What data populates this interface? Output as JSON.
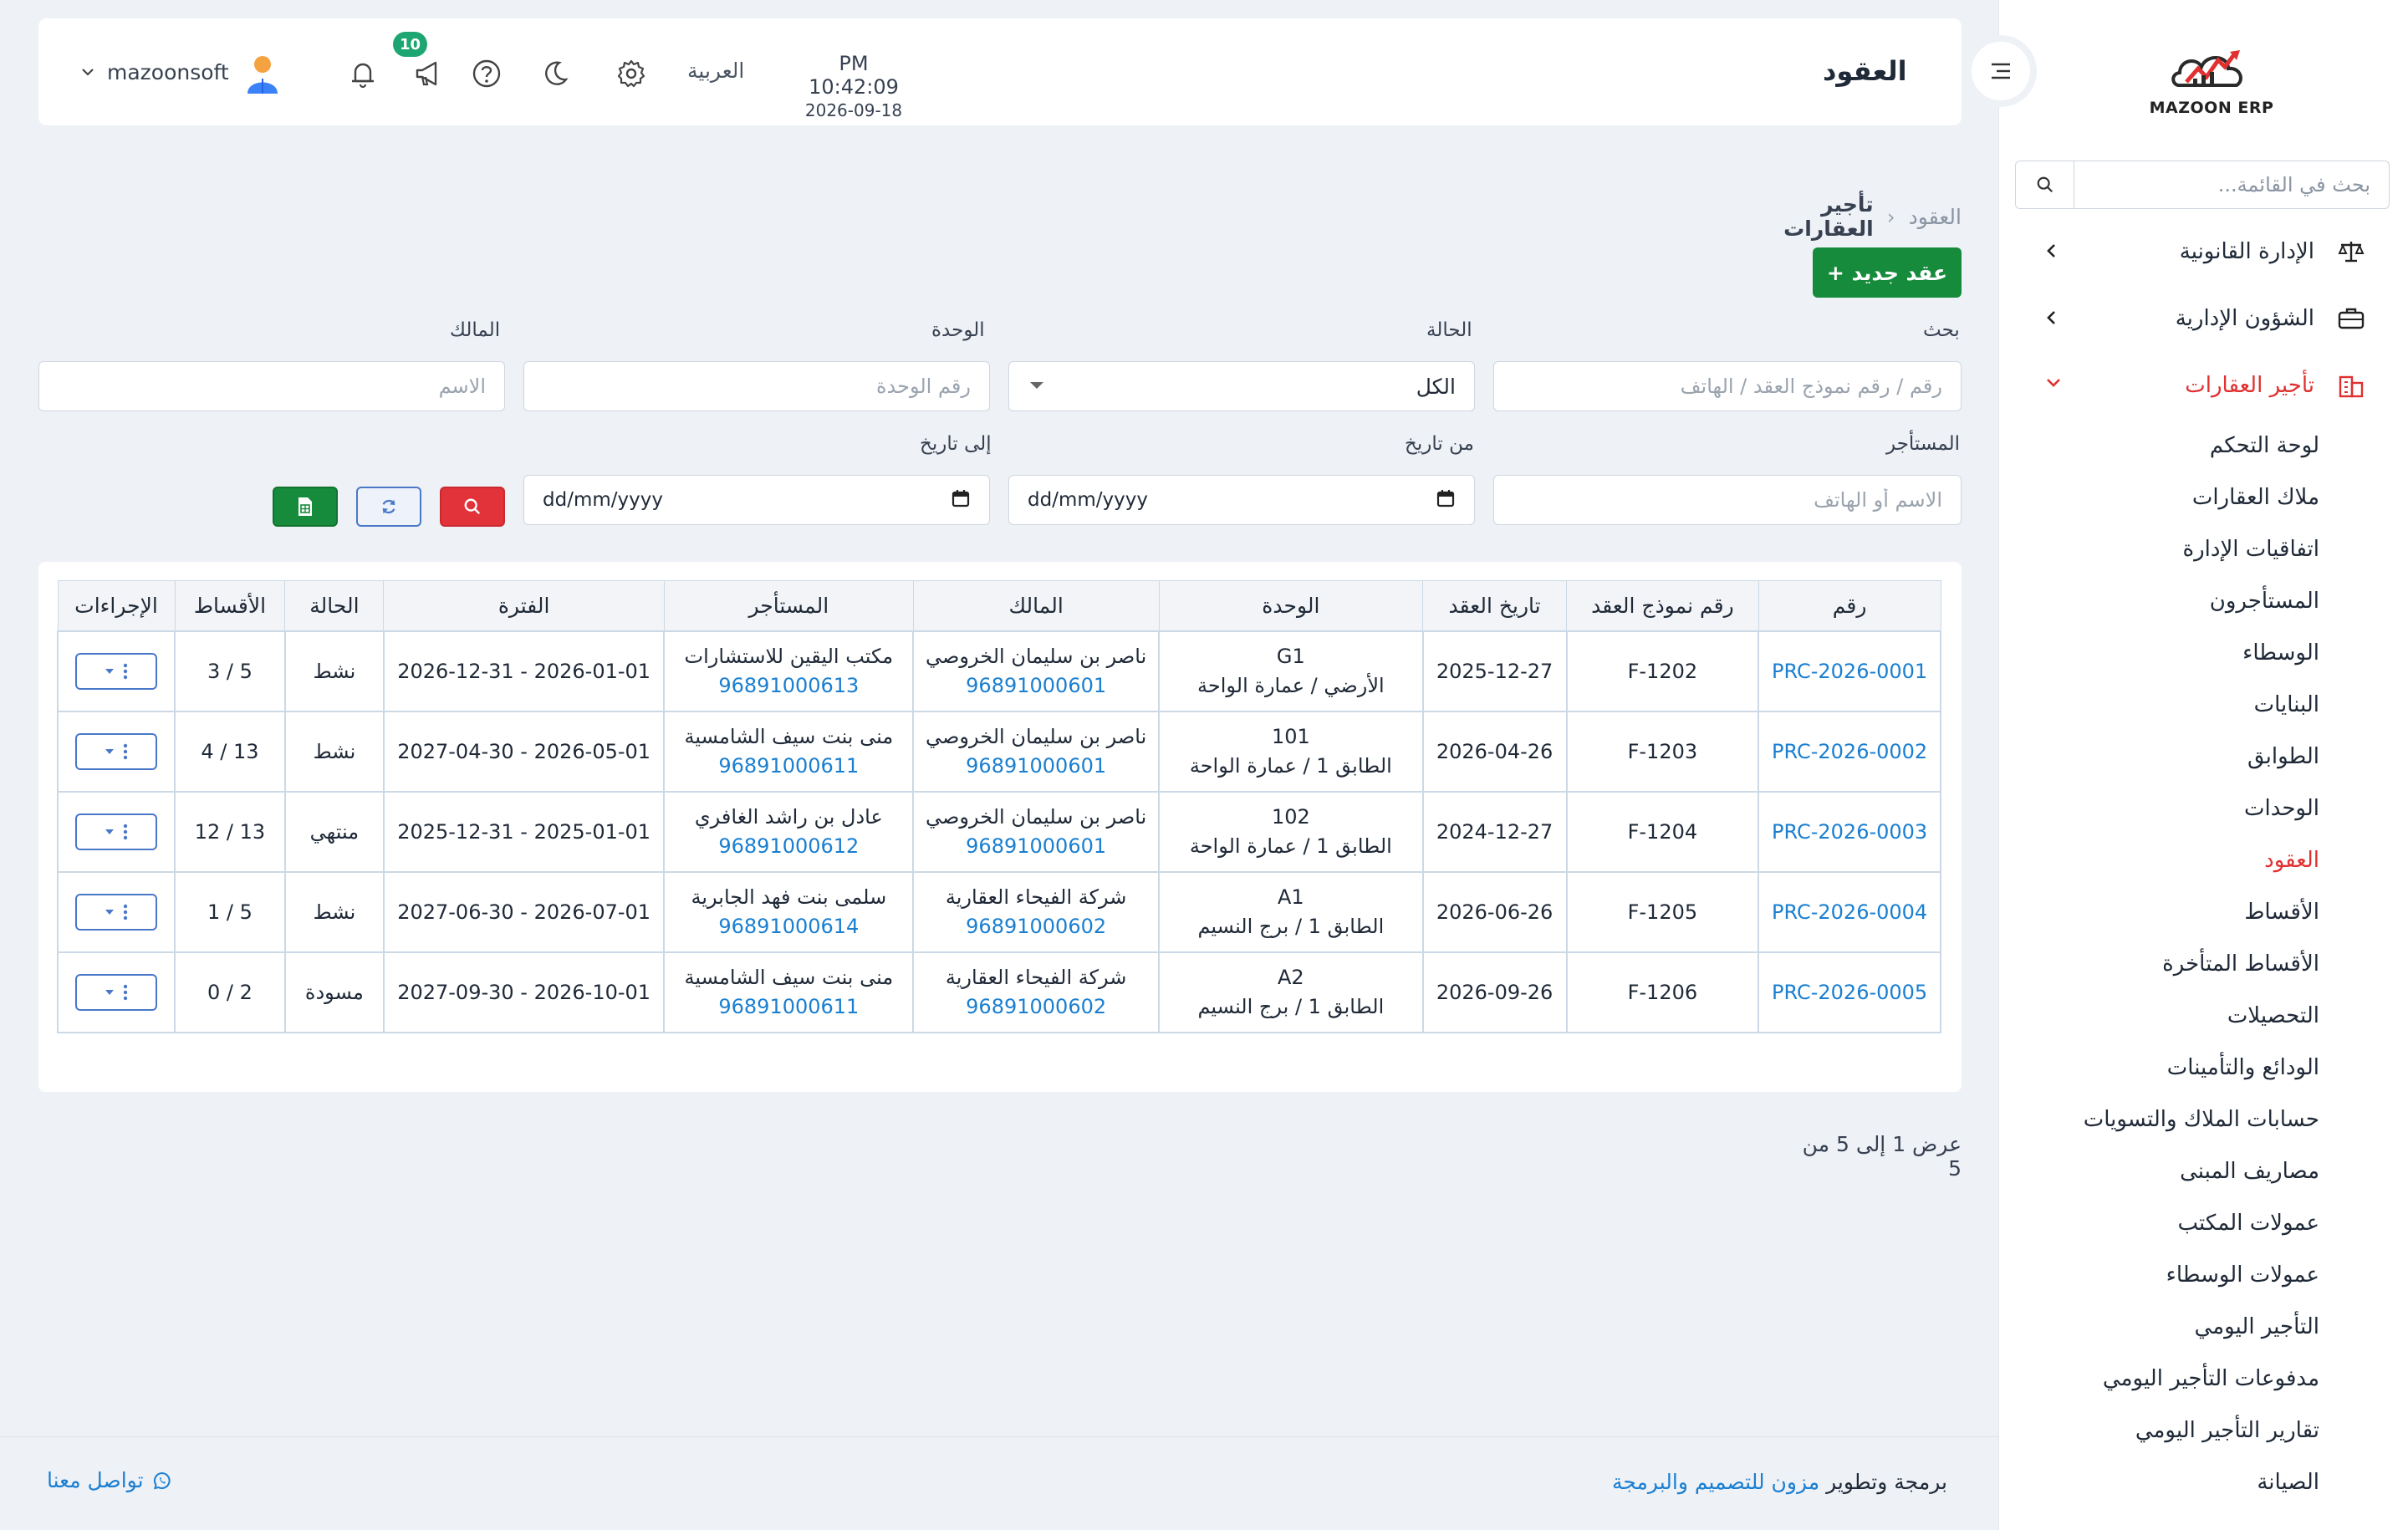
{
  "app": {
    "logo_text": "MAZOON ERP",
    "page_title": "العقود"
  },
  "header": {
    "time": "PM 10:42:09",
    "date": "2026-09-18",
    "language": "العربية",
    "notifications_count": "10",
    "username": "mazoonsoft",
    "icons": [
      "settings-icon",
      "moon-icon",
      "help-icon",
      "megaphone-icon",
      "bell-icon",
      "avatar",
      "chevron-down-icon"
    ]
  },
  "sidebar": {
    "search_placeholder": "بحث في القائمة...",
    "groups": [
      {
        "label": "الإدارة القانونية",
        "icon": "scale-icon",
        "expanded": false
      },
      {
        "label": "الشؤون الإدارية",
        "icon": "briefcase-icon",
        "expanded": false
      },
      {
        "label": "تأجير العقارات",
        "icon": "building-icon",
        "expanded": true
      }
    ],
    "sub_items": [
      "لوحة التحكم",
      "ملاك العقارات",
      "اتفاقيات الإدارة",
      "المستأجرون",
      "الوسطاء",
      "البنايات",
      "الطوابق",
      "الوحدات",
      "العقود",
      "الأقساط",
      "الأقساط المتأخرة",
      "التحصيلات",
      "الودائع والتأمينات",
      "حسابات الملاك والتسويات",
      "مصاريف المبنى",
      "عمولات المكتب",
      "عمولات الوسطاء",
      "التأجير اليومي",
      "مدفوعات التأجير اليومي",
      "تقارير التأجير اليومي",
      "الصيانة"
    ],
    "active_sub_item": "العقود"
  },
  "breadcrumb": {
    "parent": "تأجير العقارات",
    "current": "العقود"
  },
  "actions": {
    "new_contract": "+ عقد جديد"
  },
  "filters": {
    "search_label": "بحث",
    "search_placeholder": "رقم / رقم نموذج العقد / الهاتف",
    "status_label": "الحالة",
    "status_value": "الكل",
    "unit_label": "الوحدة",
    "unit_placeholder": "رقم الوحدة",
    "owner_label": "المالك",
    "owner_placeholder": "الاسم",
    "tenant_label": "المستأجر",
    "tenant_placeholder": "الاسم أو الهاتف",
    "from_label": "من تاريخ",
    "from_value": "dd/mm/yyyy",
    "to_label": "إلى تاريخ",
    "to_value": "dd/mm/yyyy"
  },
  "table": {
    "columns": [
      "رقم",
      "رقم نموذج العقد",
      "تاريخ العقد",
      "الوحدة",
      "المالك",
      "المستأجر",
      "الفترة",
      "الحالة",
      "الأقساط",
      "الإجراءات"
    ],
    "rows": [
      {
        "id": "PRC-2026-0001",
        "form_no": "F-1202",
        "date": "2025-12-27",
        "unit_code": "G1",
        "unit_loc": "الأرضي / عمارة الواحة",
        "owner": "ناصر بن سليمان الخروصي",
        "owner_phone": "96891000601",
        "tenant": "مكتب اليقين للاستشارات",
        "tenant_phone": "96891000613",
        "period": "2026-01-01 - 2026-12-31",
        "status": "نشط",
        "installments": "5 / 3"
      },
      {
        "id": "PRC-2026-0002",
        "form_no": "F-1203",
        "date": "2026-04-26",
        "unit_code": "101",
        "unit_loc": "الطابق 1 / عمارة الواحة",
        "owner": "ناصر بن سليمان الخروصي",
        "owner_phone": "96891000601",
        "tenant": "منى بنت سيف الشامسية",
        "tenant_phone": "96891000611",
        "period": "2026-05-01 - 2027-04-30",
        "status": "نشط",
        "installments": "13 / 4"
      },
      {
        "id": "PRC-2026-0003",
        "form_no": "F-1204",
        "date": "2024-12-27",
        "unit_code": "102",
        "unit_loc": "الطابق 1 / عمارة الواحة",
        "owner": "ناصر بن سليمان الخروصي",
        "owner_phone": "96891000601",
        "tenant": "عادل بن راشد الغافري",
        "tenant_phone": "96891000612",
        "period": "2025-01-01 - 2025-12-31",
        "status": "منتهي",
        "installments": "13 / 12"
      },
      {
        "id": "PRC-2026-0004",
        "form_no": "F-1205",
        "date": "2026-06-26",
        "unit_code": "A1",
        "unit_loc": "الطابق 1 / برج النسيم",
        "owner": "شركة الفيحاء العقارية",
        "owner_phone": "96891000602",
        "tenant": "سلمى بنت فهد الجابرية",
        "tenant_phone": "96891000614",
        "period": "2026-07-01 - 2027-06-30",
        "status": "نشط",
        "installments": "5 / 1"
      },
      {
        "id": "PRC-2026-0005",
        "form_no": "F-1206",
        "date": "2026-09-26",
        "unit_code": "A2",
        "unit_loc": "الطابق 1 / برج النسيم",
        "owner": "شركة الفيحاء العقارية",
        "owner_phone": "96891000602",
        "tenant": "منى بنت سيف الشامسية",
        "tenant_phone": "96891000611",
        "period": "2026-10-01 - 2027-09-30",
        "status": "مسودة",
        "installments": "2 / 0"
      }
    ]
  },
  "pagination": {
    "info": "عرض 1 إلى 5 من 5"
  },
  "footer": {
    "credit_prefix": "برمجة وتطوير",
    "credit_company": "مزون للتصميم والبرمجة",
    "contact": "تواصل معنا"
  },
  "colors": {
    "primary_green": "#168b3c",
    "danger_red": "#e0302f",
    "link_blue": "#1a7fd1",
    "badge_green": "#1ea672",
    "background": "#eef1f6"
  }
}
